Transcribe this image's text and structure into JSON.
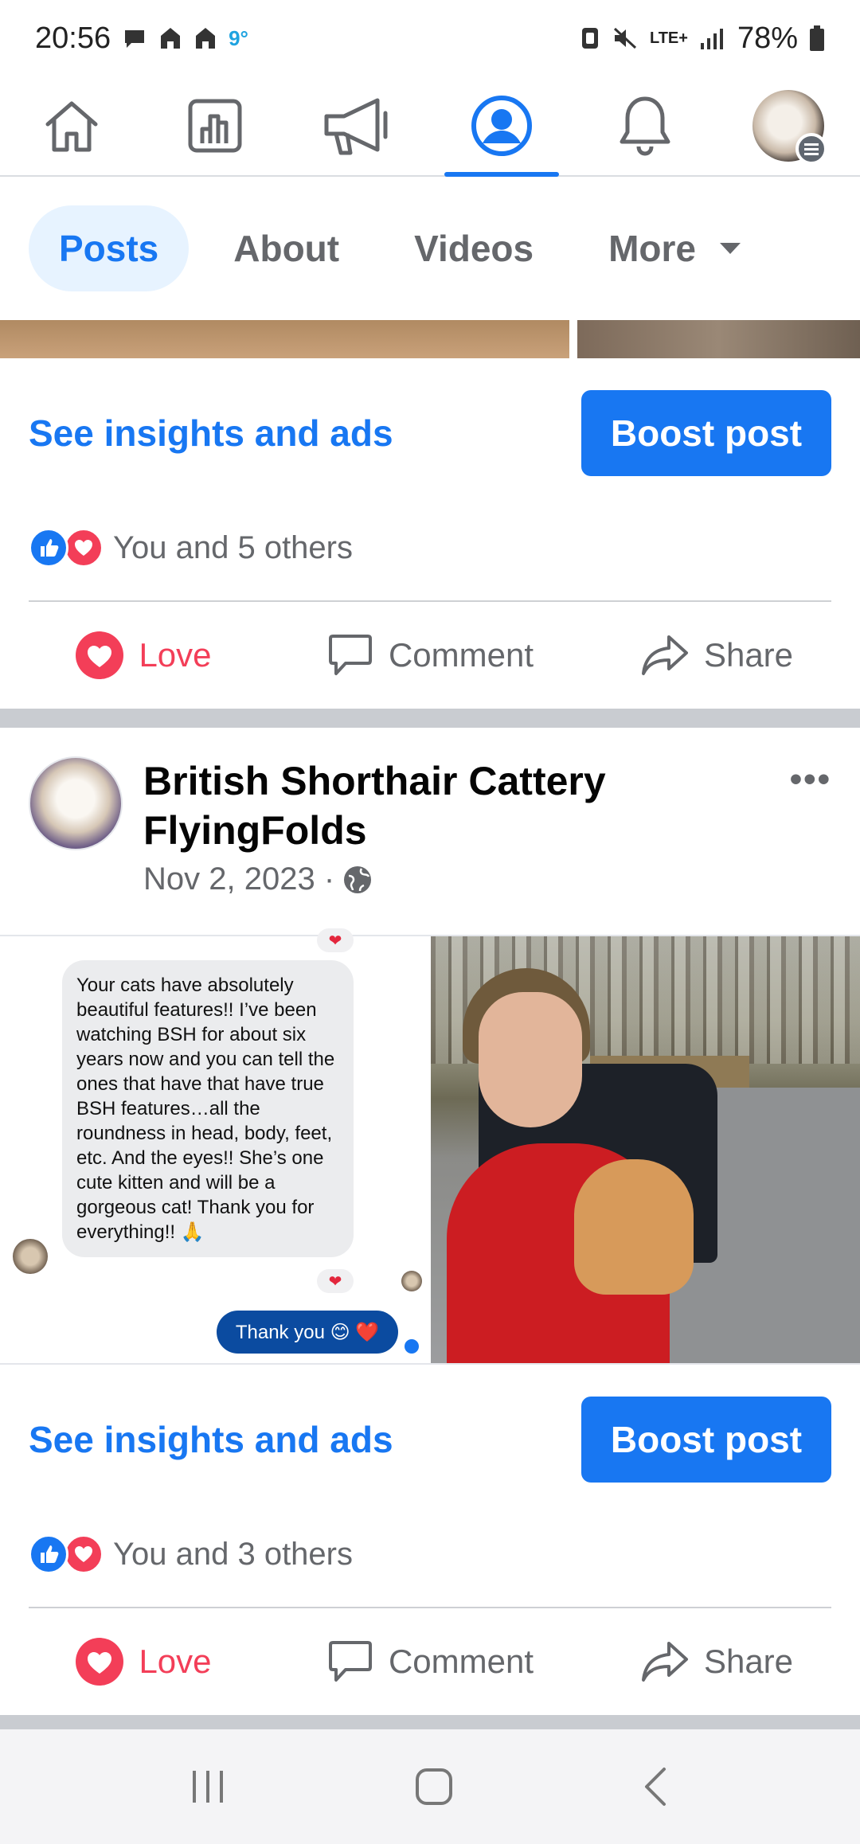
{
  "status_bar": {
    "time": "20:56",
    "temperature": "9°",
    "network": "LTE+",
    "battery": "78%"
  },
  "top_nav": {
    "items": [
      {
        "icon": "home-icon"
      },
      {
        "icon": "dashboard-icon"
      },
      {
        "icon": "megaphone-icon"
      },
      {
        "icon": "profile-icon",
        "active": true
      },
      {
        "icon": "bell-icon"
      },
      {
        "icon": "account-avatar"
      }
    ]
  },
  "tabs": {
    "posts": "Posts",
    "about": "About",
    "videos": "Videos",
    "more": "More"
  },
  "post1": {
    "insights_label": "See insights and ads",
    "boost_label": "Boost post",
    "reactions_text": "You and 5 others",
    "love_label": "Love",
    "comment_label": "Comment",
    "share_label": "Share"
  },
  "post2": {
    "author": "British Shorthair Cattery FlyingFolds",
    "date": "Nov 2, 2023 ·",
    "chat_message": "Your cats have absolutely beautiful features!! I’ve been watching BSH for about six years now and you can tell the ones that have that have true BSH features…all the roundness in head, body, feet, etc. And the eyes!! She’s one cute kitten and will be a gorgeous cat! Thank you for everything!! 🙏",
    "chat_reply": "Thank you 😊 ❤️",
    "insights_label": "See insights and ads",
    "boost_label": "Boost post",
    "reactions_text": "You and 3 others",
    "love_label": "Love",
    "comment_label": "Comment",
    "share_label": "Share"
  },
  "colors": {
    "accent": "#1877f2",
    "love": "#f33e58",
    "secondary_text": "#65676b"
  }
}
